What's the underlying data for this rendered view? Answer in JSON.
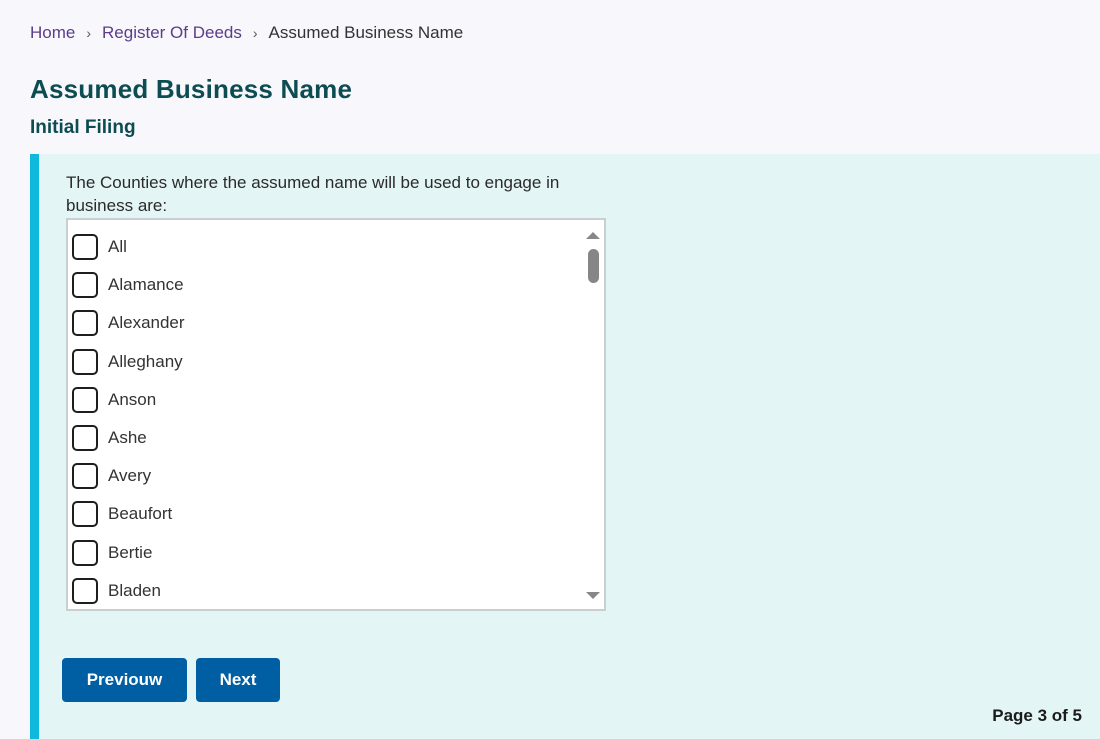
{
  "breadcrumb": {
    "items": [
      {
        "label": "Home"
      },
      {
        "label": "Register Of Deeds"
      },
      {
        "label": "Assumed Business Name"
      }
    ],
    "separator_icon": "chevron-right-icon"
  },
  "header": {
    "title": "Assumed Business Name",
    "subtitle": "Initial Filing"
  },
  "form": {
    "question": "The Counties where the assumed name will be used to engage in business are:",
    "counties": [
      {
        "label": "All",
        "checked": false
      },
      {
        "label": "Alamance",
        "checked": false
      },
      {
        "label": "Alexander",
        "checked": false
      },
      {
        "label": "Alleghany",
        "checked": false
      },
      {
        "label": "Anson",
        "checked": false
      },
      {
        "label": "Ashe",
        "checked": false
      },
      {
        "label": "Avery",
        "checked": false
      },
      {
        "label": "Beaufort",
        "checked": false
      },
      {
        "label": "Bertie",
        "checked": false
      },
      {
        "label": "Bladen",
        "checked": false
      }
    ]
  },
  "buttons": {
    "previous_label": "Previouw",
    "next_label": "Next"
  },
  "pagination": {
    "text": "Page 3 of 5"
  },
  "colors": {
    "accent_bar": "#0fb9dc",
    "panel_bg": "#e4f5f6",
    "title": "#0d4d52",
    "button": "#005ea2",
    "link": "#5b3d8a"
  }
}
